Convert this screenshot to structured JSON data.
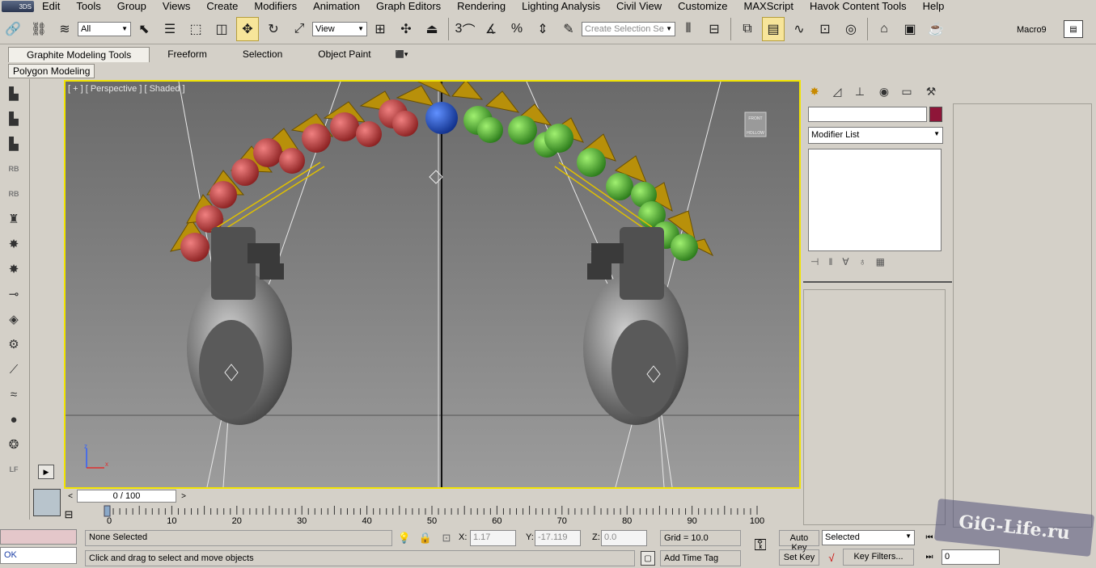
{
  "app": {
    "logo": "3DS"
  },
  "menu": [
    "Edit",
    "Tools",
    "Group",
    "Views",
    "Create",
    "Modifiers",
    "Animation",
    "Graph Editors",
    "Rendering",
    "Lighting Analysis",
    "Civil View",
    "Customize",
    "MAXScript",
    "Havok Content Tools",
    "Help"
  ],
  "toolbar": {
    "selection_filter": "All",
    "ref_coord": "View",
    "named_selection_placeholder": "Create Selection Se",
    "snap_label": "3",
    "macro_label": "Macro9"
  },
  "ribbon": {
    "tabs": [
      "Graphite Modeling Tools",
      "Freeform",
      "Selection",
      "Object Paint"
    ],
    "panel": "Polygon Modeling"
  },
  "left_tools": [
    "RB",
    "RB",
    "LF"
  ],
  "viewport": {
    "label": "[ + ] [ Perspective ] [ Shaded ]",
    "viewcube_top": "FRONT",
    "viewcube_bottom": "HOLLOW",
    "axis_x": "x",
    "axis_z": "z"
  },
  "time": {
    "slider_label": "0 / 100",
    "ticks": [
      "0",
      "10",
      "20",
      "30",
      "40",
      "50",
      "60",
      "70",
      "80",
      "90",
      "100"
    ]
  },
  "command_panel": {
    "modifier_list": "Modifier List",
    "color": "#8e1538"
  },
  "status": {
    "listener_result": "OK",
    "selection": "None Selected",
    "prompt": "Click and drag to select and move objects",
    "x_label": "X:",
    "x_value": "1.17",
    "y_label": "Y:",
    "y_value": "-17.119",
    "z_label": "Z:",
    "z_value": "0.0",
    "grid": "Grid = 10.0",
    "add_time_tag": "Add Time Tag",
    "auto_key": "Auto Key",
    "set_key": "Set Key",
    "key_mode": "Selected",
    "key_filters": "Key Filters...",
    "frame": "0"
  },
  "watermark": "GiG-Life.ru"
}
